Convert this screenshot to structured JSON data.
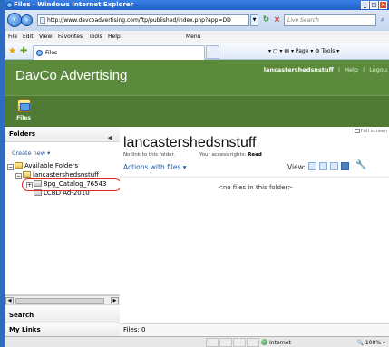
{
  "window": {
    "title": "Files - Windows Internet Explorer",
    "buttons": {
      "minimize": "_",
      "maximize": "□",
      "close": "×"
    }
  },
  "address_bar": {
    "url": "http://www.davcoadvertising.com/ftp/published/index.php?app=DD",
    "search_placeholder": "Live Search"
  },
  "menu": [
    "File",
    "Edit",
    "View",
    "Favorites",
    "Tools",
    "Help"
  ],
  "menu_extra": "Menu",
  "tab": {
    "label": "Files"
  },
  "command_bar": "▾ ▢ ▾ ▤ ▾ Page ▾ ⚙ Tools ▾",
  "app": {
    "brand": "DavCo Advertising",
    "username": "lancastershedsnstuff",
    "help": "Help",
    "logout": "Logou",
    "separator": "|",
    "files_button": "Files"
  },
  "left_panel": {
    "heading": "Folders",
    "collapse": "◀",
    "create_new": "Create new ▾",
    "tree": [
      {
        "label": "Available Folders"
      },
      {
        "label": "lancastershedsnstuff"
      },
      {
        "label": "8pg_Catalog_76543"
      },
      {
        "label": "LCBD Ad-2010"
      }
    ],
    "sections": [
      "Search",
      "My Links"
    ]
  },
  "main": {
    "full_screen": "Full screen",
    "folder_title": "lancastershedsnstuff",
    "no_link": "No link to this folder.",
    "rights_label": "Your access rights:",
    "rights_value": "Read",
    "actions": "Actions with files ▾",
    "view_label": "View:",
    "empty_message": "<no files in this folder>",
    "files_count": "Files: 0"
  },
  "status_bar": {
    "zone": "Internet",
    "zoom": "100%"
  },
  "colors": {
    "header_green": "#5c8a3c",
    "toolbar_green": "#4e7a33",
    "link_blue": "#1f5aa6",
    "highlight_red": "#e1261c"
  }
}
